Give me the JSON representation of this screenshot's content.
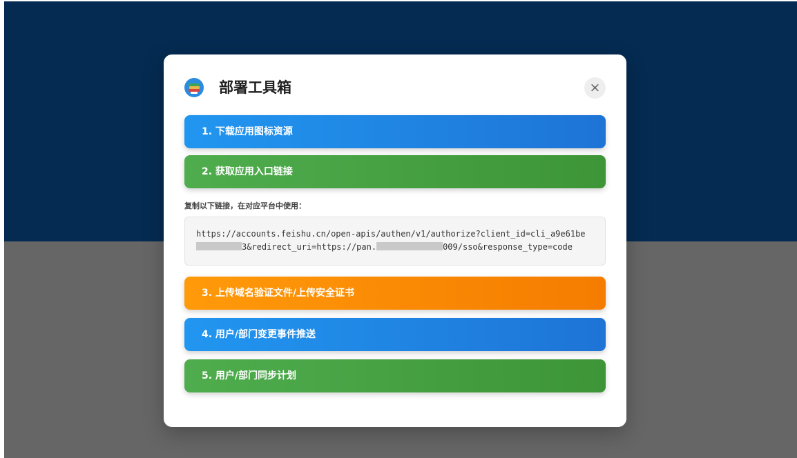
{
  "modal": {
    "title": "部署工具箱",
    "logo_icon": "book-stack-icon",
    "close_label": "×",
    "close_icon": "close-icon"
  },
  "steps": [
    {
      "label": "1. 下载应用图标资源",
      "color": "#1e88e5"
    },
    {
      "label": "2. 获取应用入口链接",
      "color": "#43a047"
    },
    {
      "label": "3. 上传域名验证文件/上传安全证书",
      "color": "#fb8c00"
    },
    {
      "label": "4. 用户/部门变更事件推送",
      "color": "#1e88e5"
    },
    {
      "label": "5. 用户/部门同步计划",
      "color": "#43a047"
    }
  ],
  "link_section": {
    "instruction": "复制以下链接，在对应平台中使用：",
    "line1": "https://accounts.feishu.cn/open-apis/authen/v1/authorize?client_id=cli_a9e61be",
    "line2_a": "3&redirect_uri=https://pan.",
    "line2_b": "009/sso&response_type=code"
  }
}
